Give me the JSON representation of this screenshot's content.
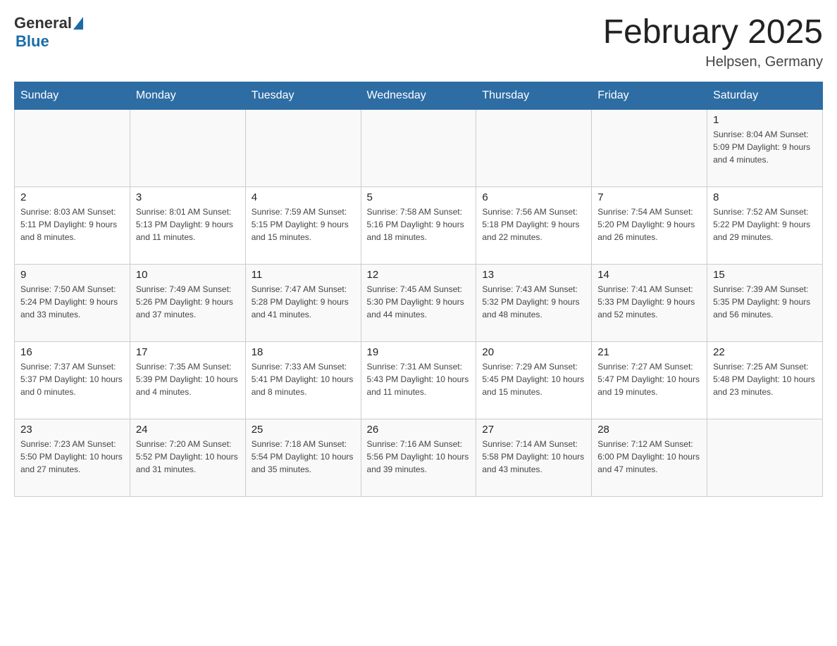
{
  "header": {
    "logo_general": "General",
    "logo_blue": "Blue",
    "title": "February 2025",
    "location": "Helpsen, Germany"
  },
  "weekdays": [
    "Sunday",
    "Monday",
    "Tuesday",
    "Wednesday",
    "Thursday",
    "Friday",
    "Saturday"
  ],
  "weeks": [
    [
      {
        "day": "",
        "info": ""
      },
      {
        "day": "",
        "info": ""
      },
      {
        "day": "",
        "info": ""
      },
      {
        "day": "",
        "info": ""
      },
      {
        "day": "",
        "info": ""
      },
      {
        "day": "",
        "info": ""
      },
      {
        "day": "1",
        "info": "Sunrise: 8:04 AM\nSunset: 5:09 PM\nDaylight: 9 hours\nand 4 minutes."
      }
    ],
    [
      {
        "day": "2",
        "info": "Sunrise: 8:03 AM\nSunset: 5:11 PM\nDaylight: 9 hours\nand 8 minutes."
      },
      {
        "day": "3",
        "info": "Sunrise: 8:01 AM\nSunset: 5:13 PM\nDaylight: 9 hours\nand 11 minutes."
      },
      {
        "day": "4",
        "info": "Sunrise: 7:59 AM\nSunset: 5:15 PM\nDaylight: 9 hours\nand 15 minutes."
      },
      {
        "day": "5",
        "info": "Sunrise: 7:58 AM\nSunset: 5:16 PM\nDaylight: 9 hours\nand 18 minutes."
      },
      {
        "day": "6",
        "info": "Sunrise: 7:56 AM\nSunset: 5:18 PM\nDaylight: 9 hours\nand 22 minutes."
      },
      {
        "day": "7",
        "info": "Sunrise: 7:54 AM\nSunset: 5:20 PM\nDaylight: 9 hours\nand 26 minutes."
      },
      {
        "day": "8",
        "info": "Sunrise: 7:52 AM\nSunset: 5:22 PM\nDaylight: 9 hours\nand 29 minutes."
      }
    ],
    [
      {
        "day": "9",
        "info": "Sunrise: 7:50 AM\nSunset: 5:24 PM\nDaylight: 9 hours\nand 33 minutes."
      },
      {
        "day": "10",
        "info": "Sunrise: 7:49 AM\nSunset: 5:26 PM\nDaylight: 9 hours\nand 37 minutes."
      },
      {
        "day": "11",
        "info": "Sunrise: 7:47 AM\nSunset: 5:28 PM\nDaylight: 9 hours\nand 41 minutes."
      },
      {
        "day": "12",
        "info": "Sunrise: 7:45 AM\nSunset: 5:30 PM\nDaylight: 9 hours\nand 44 minutes."
      },
      {
        "day": "13",
        "info": "Sunrise: 7:43 AM\nSunset: 5:32 PM\nDaylight: 9 hours\nand 48 minutes."
      },
      {
        "day": "14",
        "info": "Sunrise: 7:41 AM\nSunset: 5:33 PM\nDaylight: 9 hours\nand 52 minutes."
      },
      {
        "day": "15",
        "info": "Sunrise: 7:39 AM\nSunset: 5:35 PM\nDaylight: 9 hours\nand 56 minutes."
      }
    ],
    [
      {
        "day": "16",
        "info": "Sunrise: 7:37 AM\nSunset: 5:37 PM\nDaylight: 10 hours\nand 0 minutes."
      },
      {
        "day": "17",
        "info": "Sunrise: 7:35 AM\nSunset: 5:39 PM\nDaylight: 10 hours\nand 4 minutes."
      },
      {
        "day": "18",
        "info": "Sunrise: 7:33 AM\nSunset: 5:41 PM\nDaylight: 10 hours\nand 8 minutes."
      },
      {
        "day": "19",
        "info": "Sunrise: 7:31 AM\nSunset: 5:43 PM\nDaylight: 10 hours\nand 11 minutes."
      },
      {
        "day": "20",
        "info": "Sunrise: 7:29 AM\nSunset: 5:45 PM\nDaylight: 10 hours\nand 15 minutes."
      },
      {
        "day": "21",
        "info": "Sunrise: 7:27 AM\nSunset: 5:47 PM\nDaylight: 10 hours\nand 19 minutes."
      },
      {
        "day": "22",
        "info": "Sunrise: 7:25 AM\nSunset: 5:48 PM\nDaylight: 10 hours\nand 23 minutes."
      }
    ],
    [
      {
        "day": "23",
        "info": "Sunrise: 7:23 AM\nSunset: 5:50 PM\nDaylight: 10 hours\nand 27 minutes."
      },
      {
        "day": "24",
        "info": "Sunrise: 7:20 AM\nSunset: 5:52 PM\nDaylight: 10 hours\nand 31 minutes."
      },
      {
        "day": "25",
        "info": "Sunrise: 7:18 AM\nSunset: 5:54 PM\nDaylight: 10 hours\nand 35 minutes."
      },
      {
        "day": "26",
        "info": "Sunrise: 7:16 AM\nSunset: 5:56 PM\nDaylight: 10 hours\nand 39 minutes."
      },
      {
        "day": "27",
        "info": "Sunrise: 7:14 AM\nSunset: 5:58 PM\nDaylight: 10 hours\nand 43 minutes."
      },
      {
        "day": "28",
        "info": "Sunrise: 7:12 AM\nSunset: 6:00 PM\nDaylight: 10 hours\nand 47 minutes."
      },
      {
        "day": "",
        "info": ""
      }
    ]
  ]
}
